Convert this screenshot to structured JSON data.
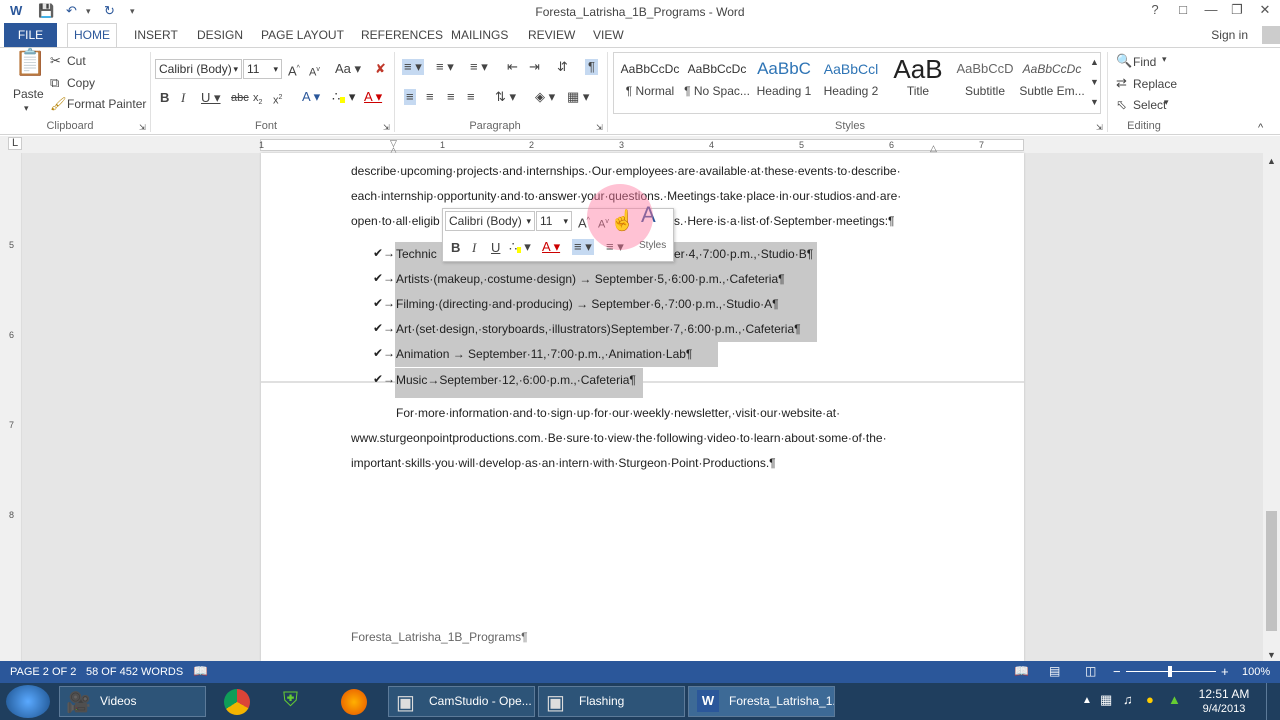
{
  "titlebar": {
    "title": "Foresta_Latrisha_1B_Programs - Word",
    "help": "?"
  },
  "tabs": {
    "file": "FILE",
    "home": "HOME",
    "insert": "INSERT",
    "design": "DESIGN",
    "page_layout": "PAGE LAYOUT",
    "references": "REFERENCES",
    "mailings": "MAILINGS",
    "review": "REVIEW",
    "view": "VIEW",
    "sign_in": "Sign in"
  },
  "clipboard": {
    "paste": "Paste",
    "cut": "Cut",
    "copy": "Copy",
    "format_painter": "Format Painter",
    "label": "Clipboard"
  },
  "font": {
    "name": "Calibri (Body)",
    "size": "11",
    "label": "Font"
  },
  "paragraph": {
    "label": "Paragraph"
  },
  "styles": {
    "label": "Styles",
    "items": [
      {
        "preview": "AaBbCcDc",
        "name": "¶ Normal"
      },
      {
        "preview": "AaBbCcDc",
        "name": "¶ No Spac..."
      },
      {
        "preview": "AaBbC",
        "name": "Heading 1"
      },
      {
        "preview": "AaBbCcl",
        "name": "Heading 2"
      },
      {
        "preview": "AaB",
        "name": "Title"
      },
      {
        "preview": "AaBbCcD",
        "name": "Subtitle"
      },
      {
        "preview": "AaBbCcDc",
        "name": "Subtle Em..."
      }
    ]
  },
  "editing": {
    "find": "Find",
    "replace": "Replace",
    "select": "Select",
    "label": "Editing"
  },
  "ruler": {
    "marks": [
      "1",
      "1",
      "2",
      "3",
      "4",
      "5",
      "6",
      "7"
    ]
  },
  "vruler": {
    "marks": [
      "5",
      "6",
      "7",
      "8"
    ]
  },
  "document": {
    "lines": [
      "describe·upcoming·projects·and·internships.·Our·employees·are·available·at·these·events·to·describe·",
      "each·internship·opportunity·and·to·answer·your·questions.·Meetings·take·place·in·our·studios·and·are·",
      "open·to·all·eligib",
      "s.·Here·is·a·list·of·September·meetings:¶"
    ],
    "bullets": [
      {
        "text": "Technic",
        "tail": "er·4,·7:00·p.m.,·Studio·B¶"
      },
      {
        "text": "Artists·(makeup,·costume·design)    →    September·5,·6:00·p.m.,·Cafeteria¶"
      },
      {
        "text": "Filming·(directing·and·producing)    →    September·6,·7:00·p.m.,·Studio·A¶"
      },
      {
        "text": "Art·(set·design,·storyboards,·illustrators)September·7,·6:00·p.m.,·Cafeteria¶"
      },
      {
        "text": "Animation   →   September·11,·7:00·p.m.,·Animation·Lab¶"
      },
      {
        "text": "Music→September·12,·6:00·p.m.,·Cafeteria¶"
      }
    ],
    "para2": [
      "For·more·information·and·to·sign·up·for·our·weekly·newsletter,·visit·our·website·at·",
      "www.sturgeonpointproductions.com.·Be·sure·to·view·the·following·video·to·learn·about·some·of·the·",
      "important·skills·you·will·develop·as·an·intern·with·Sturgeon·Point·Productions.¶"
    ],
    "footer": "Foresta_Latrisha_1B_Programs¶"
  },
  "mini_toolbar": {
    "font": "Calibri (Body)",
    "size": "11",
    "styles": "Styles"
  },
  "status": {
    "page": "PAGE 2 OF 2",
    "words": "58 OF 452 WORDS",
    "zoom": "100%"
  },
  "taskbar": {
    "items": [
      "Videos",
      "CamStudio - Ope...",
      "Flashing",
      "Foresta_Latrisha_1..."
    ],
    "time": "12:51 AM",
    "date": "9/4/2013"
  },
  "colors": {
    "accent": "#2b579a",
    "highlight": "#c8c8c8",
    "taskbar": "#1f3e5e"
  }
}
